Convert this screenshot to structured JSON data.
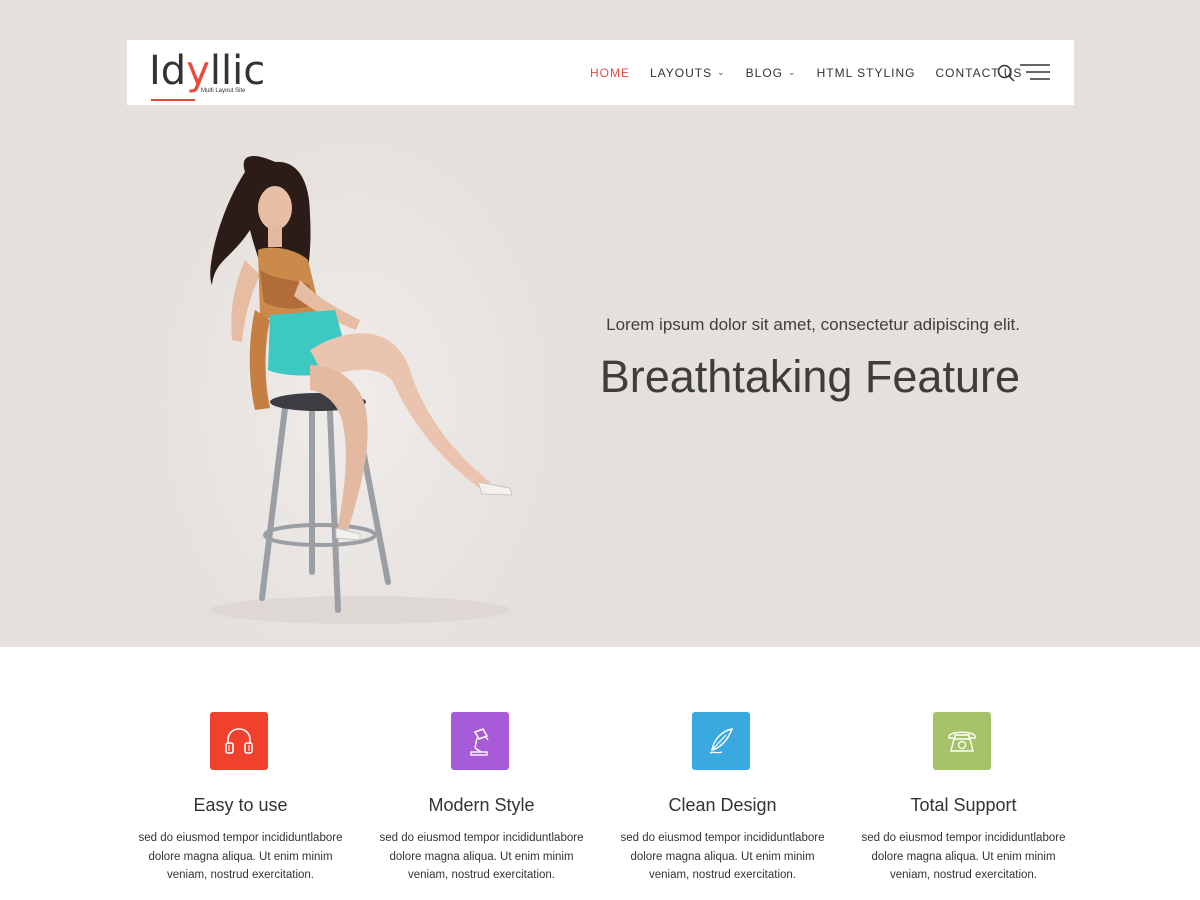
{
  "header": {
    "logo": {
      "text_start": "Id",
      "text_accent": "y",
      "text_end": "llic",
      "tagline": "Multi Layout Site"
    },
    "nav": [
      {
        "label": "HOME",
        "active": true,
        "dropdown": false
      },
      {
        "label": "LAYOUTS",
        "active": false,
        "dropdown": true
      },
      {
        "label": "BLOG",
        "active": false,
        "dropdown": true
      },
      {
        "label": "HTML STYLING",
        "active": false,
        "dropdown": false
      },
      {
        "label": "CONTACT US",
        "active": false,
        "dropdown": false
      }
    ],
    "icons": [
      "search-icon",
      "hamburger-menu-icon"
    ]
  },
  "hero": {
    "subtitle": "Lorem ipsum dolor sit amet, consectetur adipiscing elit.",
    "title": "Breathtaking Feature"
  },
  "features": [
    {
      "title": "Easy to use",
      "description": "sed do eiusmod tempor incididuntlabore dolore magna aliqua. Ut enim minim veniam, nostrud exercitation.",
      "icon": "headphones-icon",
      "color": "#f0412e"
    },
    {
      "title": "Modern Style",
      "description": "sed do eiusmod tempor incididuntlabore dolore magna aliqua. Ut enim minim veniam, nostrud exercitation.",
      "icon": "desk-lamp-icon",
      "color": "#a85bd8"
    },
    {
      "title": "Clean Design",
      "description": "sed do eiusmod tempor incididuntlabore dolore magna aliqua. Ut enim minim veniam, nostrud exercitation.",
      "icon": "feather-quill-icon",
      "color": "#3aa9e0"
    },
    {
      "title": "Total Support",
      "description": "sed do eiusmod tempor incididuntlabore dolore magna aliqua. Ut enim minim veniam, nostrud exercitation.",
      "icon": "telephone-icon",
      "color": "#a6c26b"
    }
  ],
  "colors": {
    "accent": "#e74c3c",
    "hero_background": "#e5e0dc",
    "text": "#333333"
  }
}
